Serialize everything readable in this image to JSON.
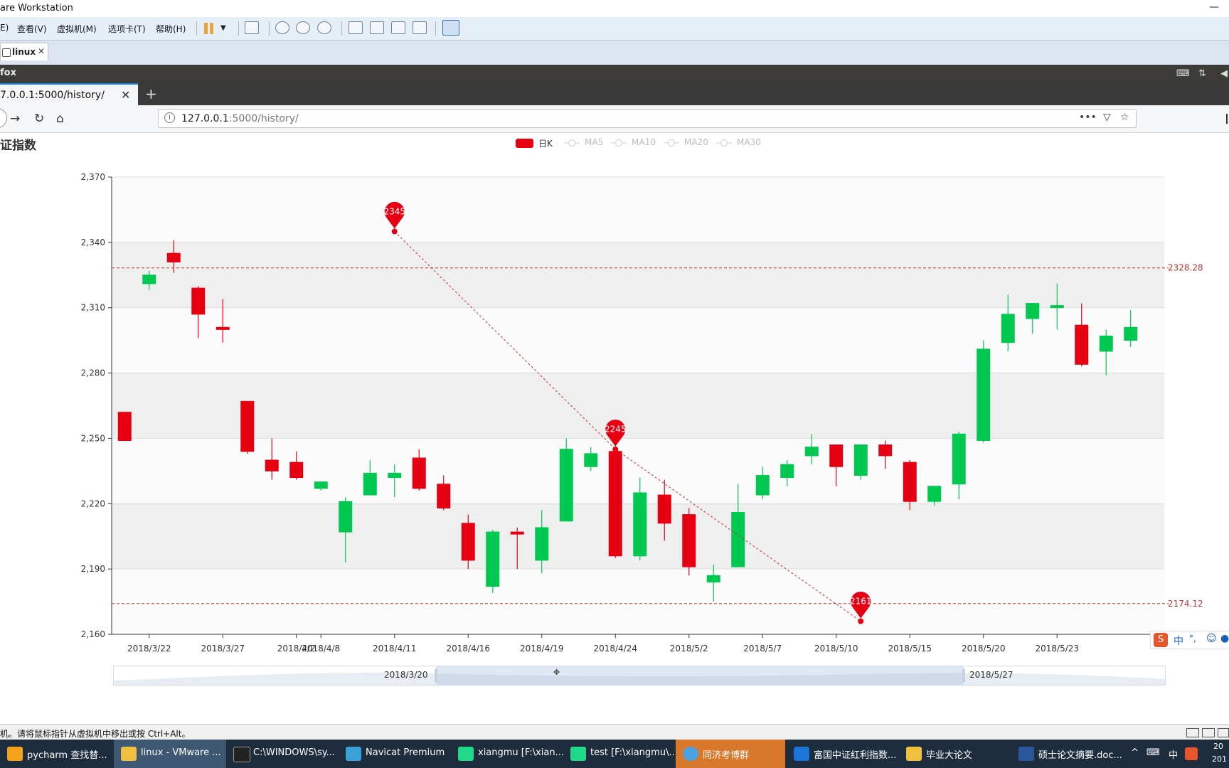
{
  "vmware": {
    "title": "are Workstation",
    "menu": [
      "E)",
      "查看(V)",
      "虚拟机(M)",
      "选项卡(T)",
      "帮助(H)"
    ],
    "tab_label": "linux",
    "status_text": "机。请将鼠标指针从虚拟机中移出或按 Ctrl+Alt。"
  },
  "guest": {
    "panel_title": "fox"
  },
  "firefox": {
    "tab_title": "7.0.0.1:5000/history/",
    "url_host": "127.0.0.1",
    "url_path": ":5000/history/"
  },
  "page": {
    "title": "证指数"
  },
  "chart_data": {
    "type": "candlestick",
    "legend": [
      "日K",
      "MA5",
      "MA10",
      "MA20",
      "MA30"
    ],
    "ylim": [
      2160,
      2370
    ],
    "yticks": [
      2160,
      2190,
      2220,
      2250,
      2280,
      2310,
      2340,
      2370
    ],
    "ytick_labels": [
      "2,160",
      "2,190",
      "2,220",
      "2,250",
      "2,280",
      "2,310",
      "2,340",
      "2,370"
    ],
    "xtick_labels": [
      {
        "label": "2018/3/22",
        "idx": 1
      },
      {
        "label": "2018/3/27",
        "idx": 4
      },
      {
        "label": "2018/4/2",
        "idx": 7
      },
      {
        "label": "2018/4/8",
        "idx": 8
      },
      {
        "label": "2018/4/11",
        "idx": 11
      },
      {
        "label": "2018/4/16",
        "idx": 14
      },
      {
        "label": "2018/4/19",
        "idx": 17
      },
      {
        "label": "2018/4/24",
        "idx": 20
      },
      {
        "label": "2018/5/2",
        "idx": 23
      },
      {
        "label": "2018/5/7",
        "idx": 26
      },
      {
        "label": "2018/5/10",
        "idx": 29
      },
      {
        "label": "2018/5/15",
        "idx": 32
      },
      {
        "label": "2018/5/20",
        "idx": 35
      },
      {
        "label": "2018/5/23",
        "idx": 38
      }
    ],
    "candles": [
      {
        "o": 2249,
        "c": 2262,
        "l": 2249,
        "h": 2262
      },
      {
        "o": 2325,
        "c": 2321,
        "l": 2318,
        "h": 2327
      },
      {
        "o": 2331,
        "c": 2335,
        "l": 2326,
        "h": 2341
      },
      {
        "o": 2307,
        "c": 2319,
        "l": 2296,
        "h": 2320
      },
      {
        "o": 2300,
        "c": 2301,
        "l": 2294,
        "h": 2314
      },
      {
        "o": 2244,
        "c": 2267,
        "l": 2243,
        "h": 2267
      },
      {
        "o": 2235,
        "c": 2240,
        "l": 2231,
        "h": 2250
      },
      {
        "o": 2232,
        "c": 2239,
        "l": 2231,
        "h": 2244
      },
      {
        "o": 2230,
        "c": 2227,
        "l": 2226,
        "h": 2230
      },
      {
        "o": 2221,
        "c": 2207,
        "l": 2193,
        "h": 2223
      },
      {
        "o": 2234,
        "c": 2224,
        "l": 2224,
        "h": 2240
      },
      {
        "o": 2234,
        "c": 2232,
        "l": 2223,
        "h": 2238
      },
      {
        "o": 2227,
        "c": 2241,
        "l": 2226,
        "h": 2245
      },
      {
        "o": 2218,
        "c": 2229,
        "l": 2217,
        "h": 2233
      },
      {
        "o": 2194,
        "c": 2211,
        "l": 2190,
        "h": 2215
      },
      {
        "o": 2207,
        "c": 2182,
        "l": 2179,
        "h": 2208
      },
      {
        "o": 2206,
        "c": 2207,
        "l": 2190,
        "h": 2209
      },
      {
        "o": 2209,
        "c": 2194,
        "l": 2188,
        "h": 2217
      },
      {
        "o": 2245,
        "c": 2212,
        "l": 2212,
        "h": 2250
      },
      {
        "o": 2243,
        "c": 2237,
        "l": 2235,
        "h": 2246
      },
      {
        "o": 2196,
        "c": 2244,
        "l": 2195,
        "h": 2244
      },
      {
        "o": 2225,
        "c": 2196,
        "l": 2194,
        "h": 2232
      },
      {
        "o": 2211,
        "c": 2224,
        "l": 2203,
        "h": 2231
      },
      {
        "o": 2191,
        "c": 2215,
        "l": 2187,
        "h": 2218
      },
      {
        "o": 2187,
        "c": 2184,
        "l": 2175,
        "h": 2192
      },
      {
        "o": 2216,
        "c": 2191,
        "l": 2191,
        "h": 2229
      },
      {
        "o": 2233,
        "c": 2224,
        "l": 2222,
        "h": 2237
      },
      {
        "o": 2238,
        "c": 2232,
        "l": 2228,
        "h": 2240
      },
      {
        "o": 2246,
        "c": 2242,
        "l": 2238,
        "h": 2252
      },
      {
        "o": 2237,
        "c": 2247,
        "l": 2228,
        "h": 2247
      },
      {
        "o": 2247,
        "c": 2233,
        "l": 2231,
        "h": 2247
      },
      {
        "o": 2242,
        "c": 2247,
        "l": 2236,
        "h": 2249
      },
      {
        "o": 2221,
        "c": 2239,
        "l": 2217,
        "h": 2240
      },
      {
        "o": 2228,
        "c": 2221,
        "l": 2219,
        "h": 2228
      },
      {
        "o": 2252,
        "c": 2229,
        "l": 2222,
        "h": 2253
      },
      {
        "o": 2291,
        "c": 2249,
        "l": 2248,
        "h": 2295
      },
      {
        "o": 2307,
        "c": 2294,
        "l": 2290,
        "h": 2316
      },
      {
        "o": 2312,
        "c": 2305,
        "l": 2298,
        "h": 2312
      },
      {
        "o": 2311,
        "c": 2310,
        "l": 2300,
        "h": 2321
      },
      {
        "o": 2284,
        "c": 2302,
        "l": 2283,
        "h": 2312
      },
      {
        "o": 2297,
        "c": 2290,
        "l": 2279,
        "h": 2300
      },
      {
        "o": 2301,
        "c": 2295,
        "l": 2292,
        "h": 2309
      }
    ],
    "mark_points": [
      {
        "label": "2345",
        "idx": 11,
        "y": 2345
      },
      {
        "label": "2245",
        "idx": 20,
        "y": 2245
      },
      {
        "label": "2161",
        "idx": 30,
        "y": 2166
      }
    ],
    "mark_lines": [
      {
        "label": "2328.28",
        "y": 2328.28
      },
      {
        "label": "2174.12",
        "y": 2174.12
      }
    ],
    "zoom": {
      "start_label": "2018/3/20",
      "end_label": "2018/5/27"
    },
    "colors": {
      "up": "#e60012",
      "down": "#00c850",
      "axis": "#333333",
      "mark": "#c23531"
    }
  },
  "ime": {
    "label": "中",
    "extra": "°,"
  },
  "taskbar": {
    "items": [
      {
        "label": "pycharm 查找替...",
        "color": "#f4a21b"
      },
      {
        "label": "linux - VMware ...",
        "color": "#f0c040"
      },
      {
        "label": "C:\\WINDOWS\\sy...",
        "color": "#222222"
      },
      {
        "label": "Navicat Premium",
        "color": "#3aa0d8"
      },
      {
        "label": "xiangmu [F:\\xian...",
        "color": "#21d789"
      },
      {
        "label": "test [F:\\xiangmu\\...",
        "color": "#21d789"
      },
      {
        "label": "同济考博群",
        "color": "#4aa3e0"
      },
      {
        "label": "富国中证红利指数...",
        "color": "#1b74d8"
      },
      {
        "label": "毕业大论文",
        "color": "#f0c040"
      },
      {
        "label": "硕士论文摘要.doc...",
        "color": "#2b579a"
      }
    ],
    "tray_lang": "中",
    "tray_time": "20",
    "tray_date": "201"
  }
}
